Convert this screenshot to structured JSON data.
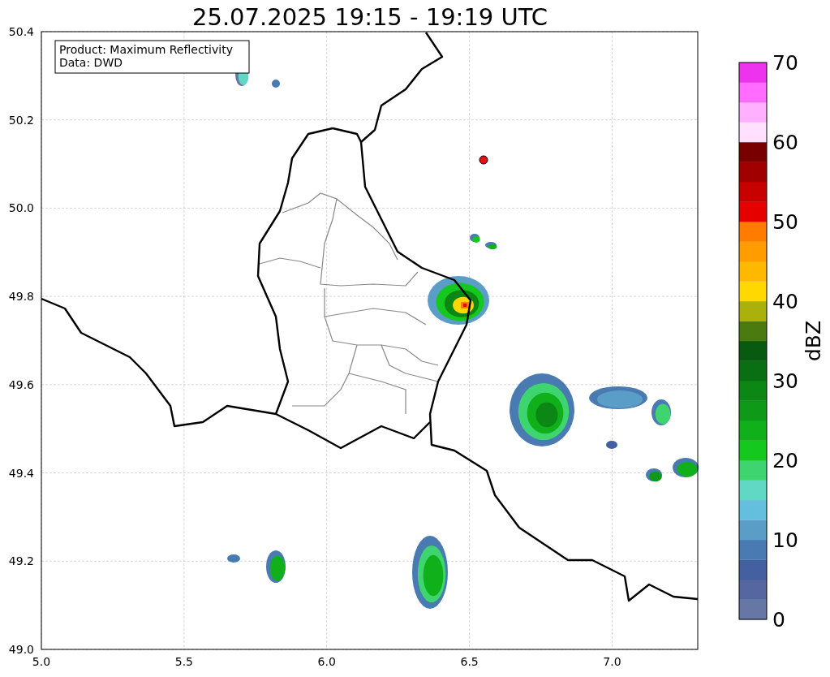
{
  "title": "25.07.2025 19:15 - 19:19 UTC",
  "info_box": [
    "Product: Maximum Reflectivity",
    "Data: DWD"
  ],
  "map": {
    "x_ticks": [
      "5.0",
      "5.5",
      "6.0",
      "6.5",
      "7.0"
    ],
    "y_ticks": [
      "50.4",
      "50.2",
      "50.0",
      "49.8",
      "49.6",
      "49.4",
      "49.2",
      "49.0"
    ]
  },
  "colorbar": {
    "label": "dBZ",
    "ticks": [
      "70",
      "60",
      "50",
      "40",
      "30",
      "20",
      "10",
      "0"
    ],
    "bands": [
      {
        "color": "#6677a6"
      },
      {
        "color": "#5566a0"
      },
      {
        "color": "#4460a0"
      },
      {
        "color": "#4a7ab2"
      },
      {
        "color": "#5a9ec8"
      },
      {
        "color": "#64bede"
      },
      {
        "color": "#60d8c4"
      },
      {
        "color": "#3ed470"
      },
      {
        "color": "#14c81e"
      },
      {
        "color": "#10b01a"
      },
      {
        "color": "#0e9a18"
      },
      {
        "color": "#0c8614"
      },
      {
        "color": "#0a6e12"
      },
      {
        "color": "#075a10"
      },
      {
        "color": "#4a7a10"
      },
      {
        "color": "#aab00c"
      },
      {
        "color": "#ffd800"
      },
      {
        "color": "#ffb800"
      },
      {
        "color": "#ff9c00"
      },
      {
        "color": "#ff7c00"
      },
      {
        "color": "#e60000"
      },
      {
        "color": "#c80000"
      },
      {
        "color": "#a00000"
      },
      {
        "color": "#780000"
      },
      {
        "color": "#ffe0ff"
      },
      {
        "color": "#ffb0ff"
      },
      {
        "color": "#ff6cff"
      },
      {
        "color": "#ee33ee"
      }
    ]
  }
}
